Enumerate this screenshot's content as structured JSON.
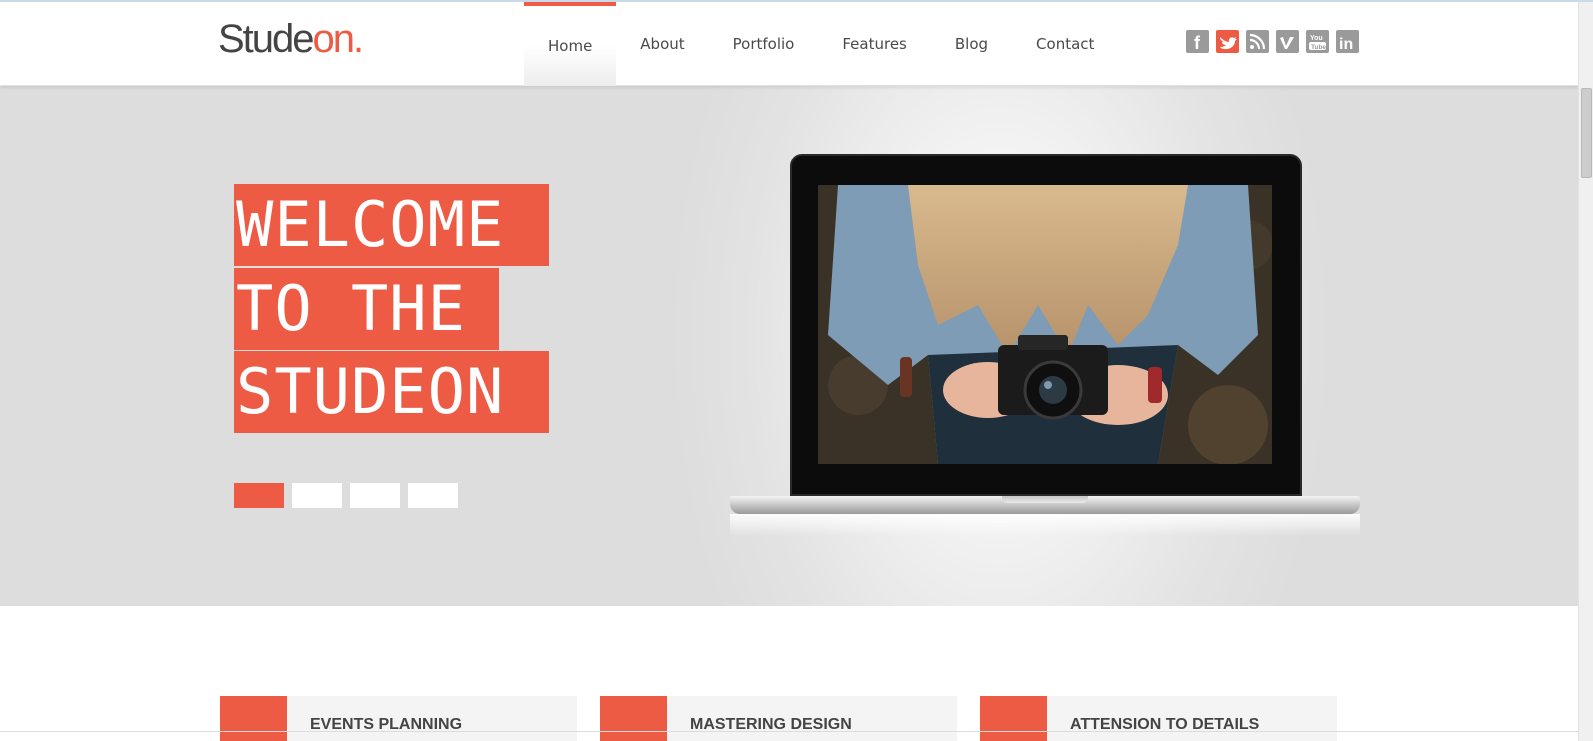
{
  "header": {
    "logo_main": "Stude",
    "logo_accent": "on."
  },
  "nav": {
    "items": [
      {
        "label": "Home",
        "active": true
      },
      {
        "label": "About"
      },
      {
        "label": "Portfolio"
      },
      {
        "label": "Features"
      },
      {
        "label": "Blog"
      },
      {
        "label": "Contact"
      }
    ]
  },
  "social": [
    {
      "icon": "facebook-icon",
      "glyph": "f"
    },
    {
      "icon": "twitter-icon",
      "glyph": "t"
    },
    {
      "icon": "rss-icon",
      "glyph": ")"
    },
    {
      "icon": "vimeo-icon",
      "glyph": "v"
    },
    {
      "icon": "youtube-icon",
      "glyph": "You Tube"
    },
    {
      "icon": "linkedin-icon",
      "glyph": "in"
    }
  ],
  "hero": {
    "lines": [
      "WELCOME",
      "TO THE",
      "STUDEON"
    ],
    "slides_total": 4,
    "active_slide": 1
  },
  "features": [
    {
      "title": "EVENTS PLANNING"
    },
    {
      "title": "MASTERING DESIGN"
    },
    {
      "title": "ATTENSION TO DETAILS"
    }
  ],
  "colors": {
    "accent": "#ee5b45",
    "text": "#4a4a4a",
    "icon_gray": "#9a9a9a"
  }
}
